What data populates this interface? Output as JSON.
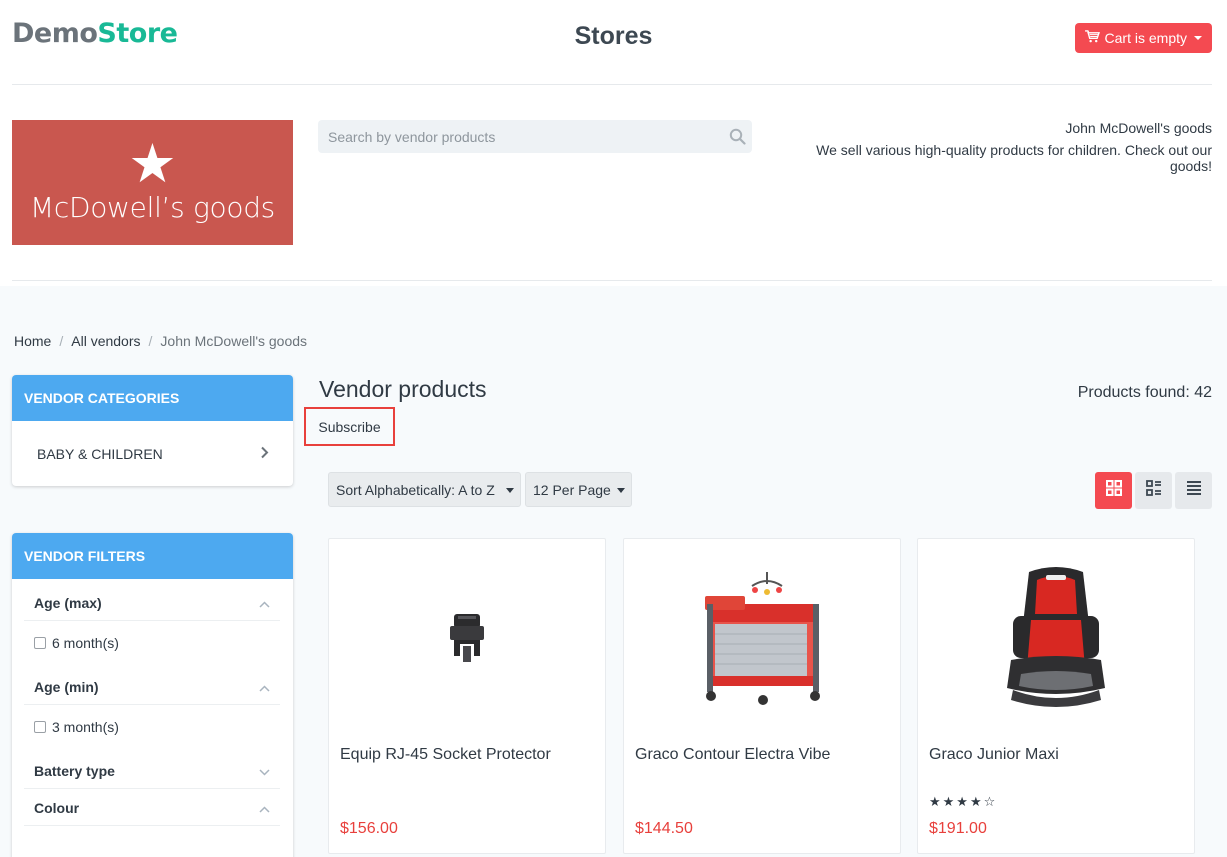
{
  "header": {
    "logo_part1": "Demo",
    "logo_part2": "Store",
    "title": "Stores",
    "cart_label": "Cart is empty"
  },
  "vendor": {
    "logo_text": "McDowell’s goods",
    "search_placeholder": "Search by vendor products",
    "name": "John McDowell's goods",
    "description": "We sell various high-quality products for children. Check out our goods!"
  },
  "breadcrumb": {
    "home": "Home",
    "sep": "/",
    "vendors": "All vendors",
    "current": "John McDowell's goods"
  },
  "categories": {
    "title": "VENDOR CATEGORIES",
    "items": [
      {
        "label": "BABY & CHILDREN"
      }
    ]
  },
  "filters": {
    "title": "VENDOR FILTERS",
    "sections": [
      {
        "label": "Age (max)",
        "option": "6 month(s)"
      },
      {
        "label": "Age (min)",
        "option": "3 month(s)"
      },
      {
        "label": "Battery type"
      },
      {
        "label": "Colour"
      }
    ]
  },
  "main": {
    "title": "Vendor products",
    "found": "Products found: 42",
    "subscribe": "Subscribe",
    "sort": "Sort Alphabetically: A to Z",
    "per_page": "12 Per Page"
  },
  "products": [
    {
      "name": "Equip RJ-45 Socket Protector",
      "price": "$156.00"
    },
    {
      "name": "Graco Contour Electra Vibe",
      "price": "$144.50"
    },
    {
      "name": "Graco Junior Maxi",
      "price": "$191.00",
      "rating": 4,
      "stars": "★★★★☆"
    }
  ],
  "colors": {
    "accent_red": "#f44a51",
    "brand_green": "#19b996",
    "sidebar_blue": "#4da9f0"
  }
}
